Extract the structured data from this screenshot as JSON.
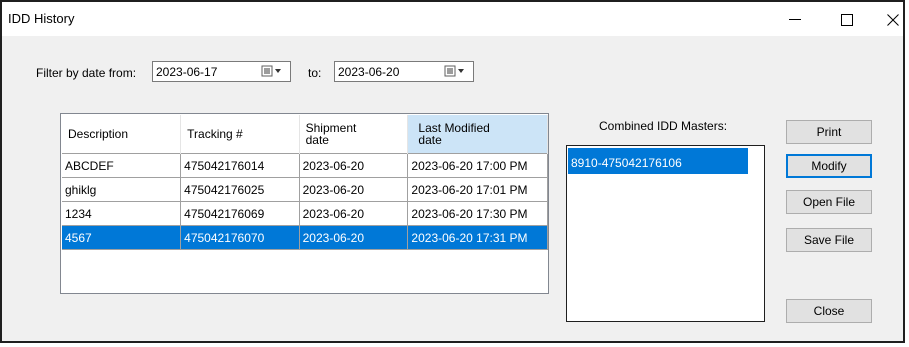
{
  "window": {
    "title": "IDD History",
    "minimize_glyph": "—",
    "close_glyph": "✕"
  },
  "filter": {
    "from_label": "Filter by date from:",
    "from_value": "2023-06-17",
    "to_label": "to:",
    "to_value": "2023-06-20"
  },
  "grid": {
    "columns": [
      {
        "line1": "Description",
        "line2": ""
      },
      {
        "line1": "Tracking #",
        "line2": ""
      },
      {
        "line1": "Shipment",
        "line2": "date"
      },
      {
        "line1": "Last Modified",
        "line2": "date"
      }
    ],
    "rows": [
      {
        "description": "ABCDEF",
        "tracking": "475042176014",
        "shipment": "2023-06-20",
        "modified": "2023-06-20 17:00 PM"
      },
      {
        "description": "ghiklg",
        "tracking": "475042176025",
        "shipment": "2023-06-20",
        "modified": "2023-06-20 17:01 PM"
      },
      {
        "description": "1234",
        "tracking": "475042176069",
        "shipment": "2023-06-20",
        "modified": "2023-06-20 17:30 PM"
      },
      {
        "description": "4567",
        "tracking": "475042176070",
        "shipment": "2023-06-20",
        "modified": "2023-06-20 17:31 PM"
      }
    ],
    "selected_row": 3
  },
  "masters": {
    "label": "Combined IDD Masters:",
    "items": [
      "8910-475042176106"
    ]
  },
  "buttons": {
    "print": "Print",
    "modify": "Modify",
    "open_file": "Open File",
    "save_file": "Save File",
    "close": "Close"
  },
  "colors": {
    "selection": "#0078d7",
    "sorted_header": "#cce4f7",
    "dialog_bg": "#f0f0f0"
  }
}
